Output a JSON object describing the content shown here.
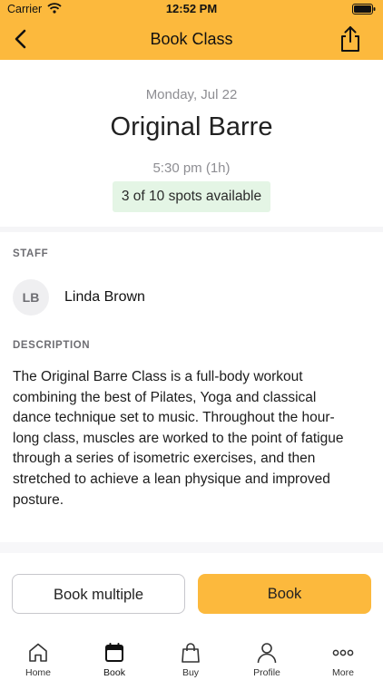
{
  "status_bar": {
    "carrier": "Carrier",
    "time": "12:52 PM",
    "icons": [
      "wifi-icon",
      "battery-icon"
    ]
  },
  "nav": {
    "title": "Book Class",
    "left_icon": "chevron-left-icon",
    "right_icon": "share-icon"
  },
  "class_info": {
    "date": "Monday, Jul 22",
    "name": "Original Barre",
    "time": "5:30 pm (1h)",
    "spots": "3 of 10 spots available"
  },
  "staff": {
    "label": "STAFF",
    "initials": "LB",
    "name": "Linda Brown"
  },
  "description": {
    "label": "DESCRIPTION",
    "text": "The Original Barre Class is a full-body workout combining the best of Pilates, Yoga and classical dance technique set to music. Throughout the hour-long class, muscles are worked to the point of fatigue through a series of isometric exercises, and then stretched to achieve a lean physique and improved posture."
  },
  "actions": {
    "book_multiple": "Book multiple",
    "book": "Book"
  },
  "tabs": [
    {
      "label": "Home",
      "icon": "home-icon",
      "active": false
    },
    {
      "label": "Book",
      "icon": "calendar-icon",
      "active": true
    },
    {
      "label": "Buy",
      "icon": "shopping-bag-icon",
      "active": false
    },
    {
      "label": "Profile",
      "icon": "person-icon",
      "active": false
    },
    {
      "label": "More",
      "icon": "more-dots-icon",
      "active": false
    }
  ],
  "colors": {
    "accent": "#fcb93d",
    "spots_badge_bg": "#e4f5e5",
    "muted_text": "#8e8e93"
  }
}
